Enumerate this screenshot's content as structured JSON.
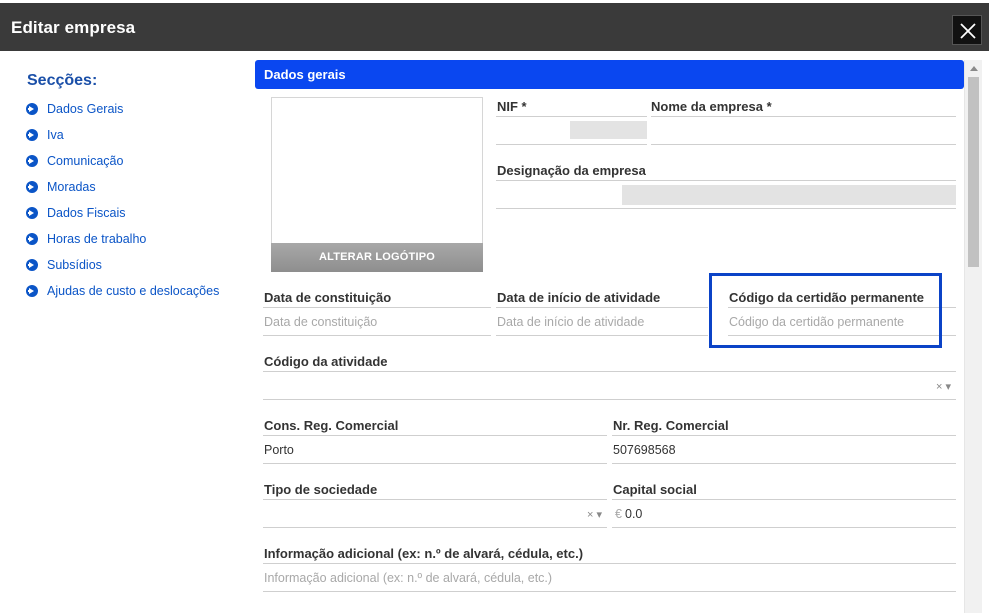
{
  "dialog": {
    "title": "Editar empresa"
  },
  "sidebar": {
    "heading": "Secções:",
    "items": [
      {
        "label": "Dados Gerais"
      },
      {
        "label": "Iva"
      },
      {
        "label": "Comunicação"
      },
      {
        "label": "Moradas"
      },
      {
        "label": "Dados Fiscais"
      },
      {
        "label": "Horas de trabalho"
      },
      {
        "label": "Subsídios"
      },
      {
        "label": "Ajudas de custo e deslocações"
      }
    ]
  },
  "section": {
    "title": "Dados gerais"
  },
  "logo": {
    "button_label": "ALTERAR LOGÓTIPO"
  },
  "fields": {
    "nif": {
      "label": "NIF *",
      "value": ""
    },
    "nome": {
      "label": "Nome da empresa *",
      "value": ""
    },
    "designacao": {
      "label": "Designação da empresa",
      "value": ""
    },
    "data_constituicao": {
      "label": "Data de constituição",
      "placeholder": "Data de constituição"
    },
    "data_inicio": {
      "label": "Data de início de atividade",
      "placeholder": "Data de início de atividade"
    },
    "codigo_certidao": {
      "label": "Código da certidão permanente",
      "placeholder": "Código da certidão permanente"
    },
    "codigo_atividade": {
      "label": "Código da atividade",
      "value": ""
    },
    "cons_reg": {
      "label": "Cons. Reg. Comercial",
      "value": "Porto"
    },
    "nr_reg": {
      "label": "Nr. Reg. Comercial",
      "value": "507698568"
    },
    "tipo_sociedade": {
      "label": "Tipo de sociedade",
      "value": ""
    },
    "capital_social": {
      "label": "Capital social",
      "prefix": "€",
      "value": "0.0"
    },
    "info_adicional": {
      "label": "Informação adicional (ex: n.º de alvará, cédula, etc.)",
      "placeholder": "Informação adicional (ex: n.º de alvará, cédula, etc.)"
    }
  },
  "select_controls": {
    "clear_glyph": "×",
    "arrow_glyph": "▾"
  },
  "colors": {
    "header_bg": "#3a3a3a",
    "accent_blue": "#0a47f0",
    "link_blue": "#0b55c7",
    "highlight_border": "#0b43c7"
  }
}
